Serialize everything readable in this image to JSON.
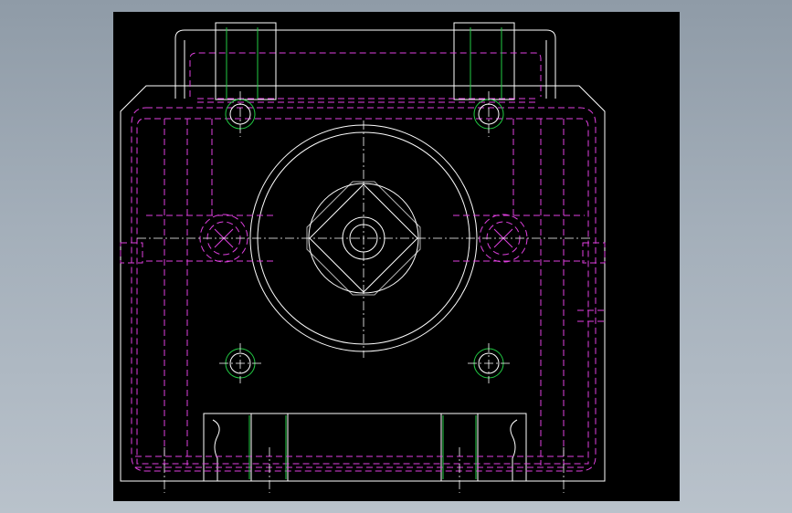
{
  "viewport": {
    "background_top": "#8f9ba7",
    "background_bottom": "#b9c2cb",
    "canvas_color": "#000000"
  },
  "drawing": {
    "type": "cad-mold-plate-top-view",
    "layers": {
      "outline": "#ffffff",
      "hidden": "#e040e0",
      "fastener": "#22cc44",
      "centerline": "#ffffff"
    },
    "features": [
      "outer-plate",
      "center-ring",
      "diamond-insert",
      "pilot-hole",
      "pins",
      "screws",
      "bottom-slot"
    ]
  }
}
